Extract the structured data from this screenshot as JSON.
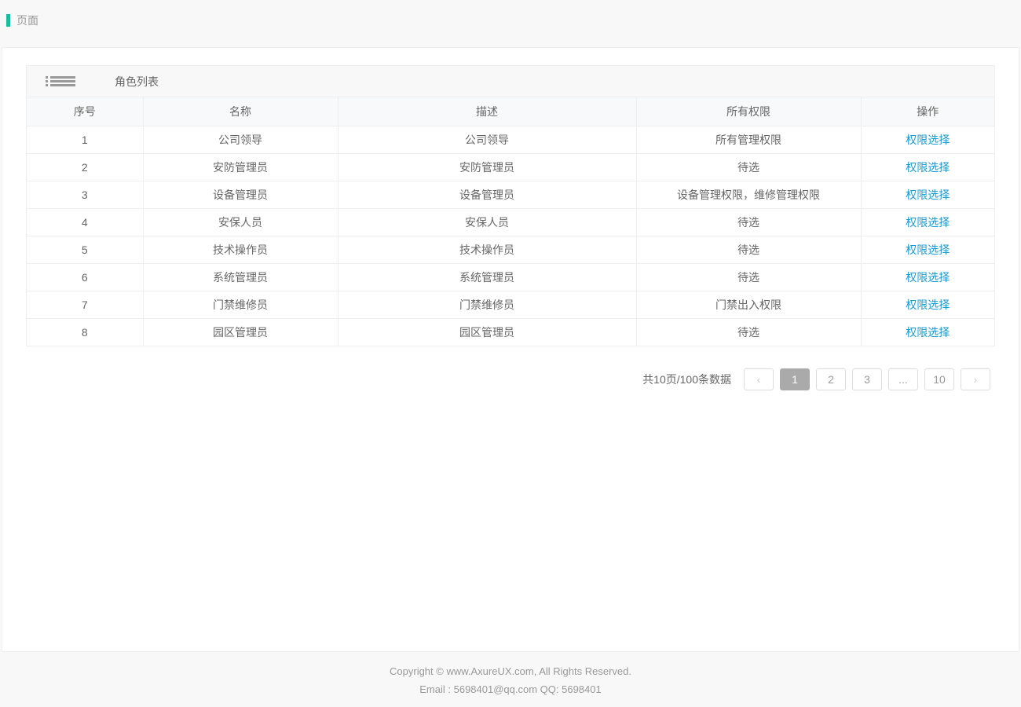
{
  "header": {
    "title": "页面"
  },
  "panel": {
    "title": "角色列表"
  },
  "table": {
    "columns": {
      "index": "序号",
      "name": "名称",
      "desc": "描述",
      "perm": "所有权限",
      "op": "操作"
    },
    "action_label": "权限选择",
    "rows": [
      {
        "index": "1",
        "name": "公司领导",
        "desc": "公司领导",
        "perm": "所有管理权限"
      },
      {
        "index": "2",
        "name": "安防管理员",
        "desc": "安防管理员",
        "perm": "待选"
      },
      {
        "index": "3",
        "name": "设备管理员",
        "desc": "设备管理员",
        "perm": "设备管理权限，维修管理权限"
      },
      {
        "index": "4",
        "name": "安保人员",
        "desc": "安保人员",
        "perm": "待选"
      },
      {
        "index": "5",
        "name": "技术操作员",
        "desc": "技术操作员",
        "perm": "待选"
      },
      {
        "index": "6",
        "name": "系统管理员",
        "desc": "系统管理员",
        "perm": "待选"
      },
      {
        "index": "7",
        "name": "门禁维修员",
        "desc": "门禁维修员",
        "perm": "门禁出入权限"
      },
      {
        "index": "8",
        "name": "园区管理员",
        "desc": "园区管理员",
        "perm": "待选"
      }
    ]
  },
  "pagination": {
    "summary": "共10页/100条数据",
    "prev": "‹",
    "next": "›",
    "pages": {
      "p1": "1",
      "p2": "2",
      "p3": "3",
      "ellipsis": "...",
      "p10": "10"
    }
  },
  "footer": {
    "line1": "Copyright © www.AxureUX.com, All Rights Reserved.",
    "line2": "Email : 5698401@qq.com  QQ: 5698401"
  }
}
